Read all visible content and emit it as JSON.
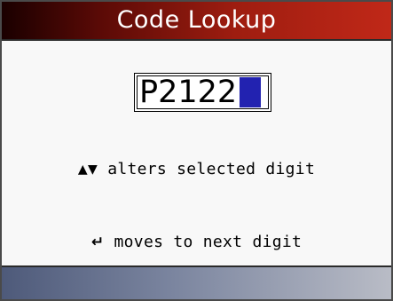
{
  "header": {
    "title": "Code Lookup"
  },
  "code_entry": {
    "value": "P2122",
    "cursor_color": "#2222b0"
  },
  "hints": {
    "alter": {
      "icon": "up-down-arrows-icon",
      "icon_glyph": "▲▼",
      "text": "alters selected digit"
    },
    "next": {
      "icon": "enter-key-icon",
      "icon_glyph": "↵",
      "text": "moves to next digit"
    }
  },
  "colors": {
    "title_bar_start": "#1a0000",
    "title_bar_end": "#c02818",
    "status_bar_start": "#4e5a7a",
    "status_bar_end": "#b9bcc6"
  }
}
